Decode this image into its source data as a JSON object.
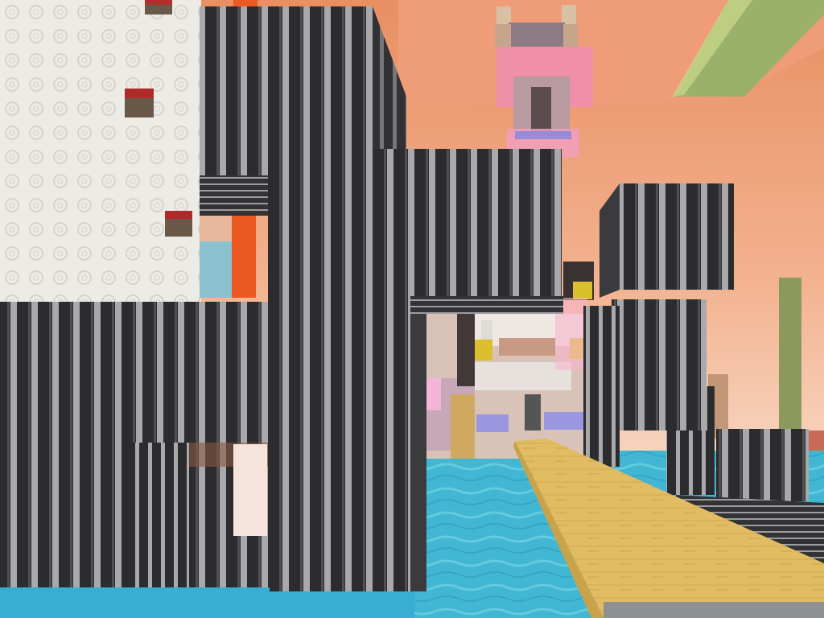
{
  "scene": {
    "description_tag": "voxel-game-first-person-view",
    "sky": {
      "top": "#e9936a",
      "horizon": "#f6cdb5"
    },
    "water": {
      "color": "#3fb6d3",
      "light": "#67cde3",
      "dark": "#2b97b5"
    },
    "stripe": {
      "dark": "#2b2b2d",
      "light": "#a7a7a9"
    },
    "plank": {
      "color": "#e2bd62",
      "side": "#c9a24c"
    },
    "quartz": {
      "color": "#ecebe6",
      "swirl": "#d2d0ca"
    },
    "wool_orange": "#ea5a22",
    "pink_block": "#ef8fa8",
    "green_block": "#8a9a5c",
    "hud": {}
  }
}
